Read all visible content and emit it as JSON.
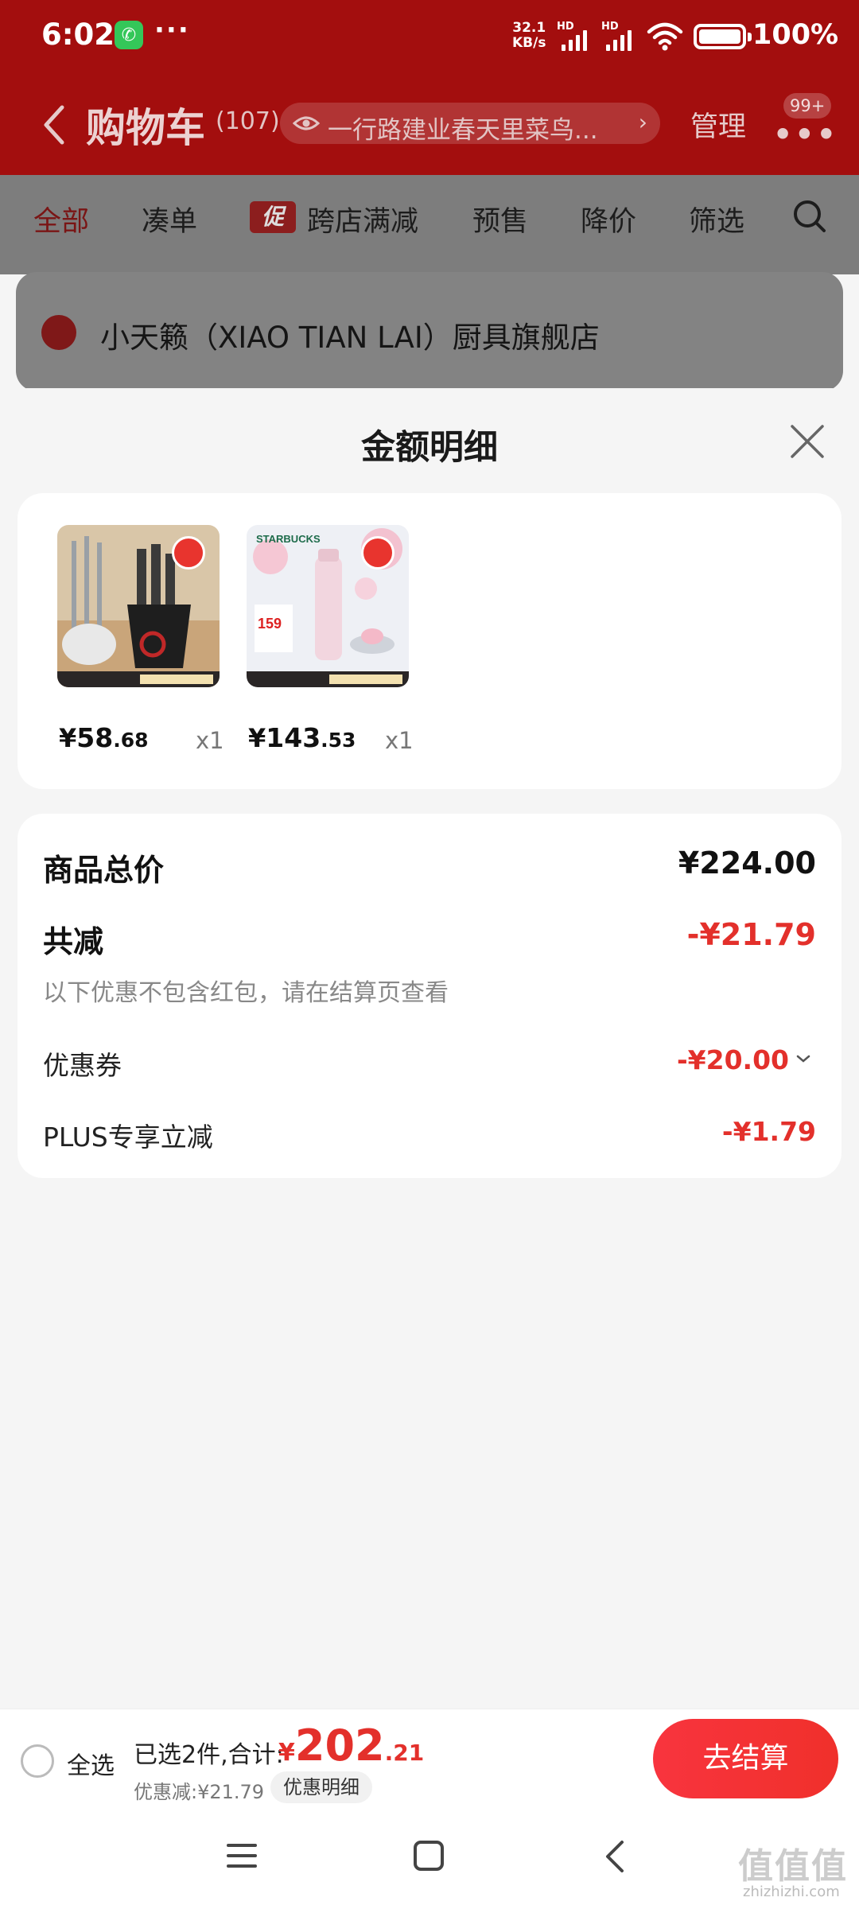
{
  "status_bar": {
    "time": "6:02",
    "more": "···",
    "net_speed_value": "32.1",
    "net_speed_unit": "KB/s",
    "sim1_label": "HD",
    "sim2_label": "HD",
    "battery": "100%"
  },
  "header": {
    "title": "购物车",
    "count": "(107)",
    "address": "一行路建业春天里菜鸟...",
    "manage": "管理",
    "badge": "99+"
  },
  "tabs": {
    "all": "全部",
    "bundle": "凑单",
    "promo_tag": "促",
    "cross_store": "跨店满减",
    "presale": "预售",
    "price_drop": "降价",
    "filter": "筛选"
  },
  "store": {
    "name": "小天籁（XIAO TIAN LAI）厨具旗舰店"
  },
  "sheet": {
    "title": "金额明细",
    "items": [
      {
        "price_yen": "¥",
        "price_int": "58",
        "price_dec": ".68",
        "qty": "x1",
        "thumb": "knife-set"
      },
      {
        "price_yen": "¥",
        "price_int": "143",
        "price_dec": ".53",
        "qty": "x1",
        "thumb": "starbucks-thermos"
      }
    ],
    "thumb_texts": {
      "starbucks": "STARBUCKS",
      "promo_price": "159"
    },
    "summary": {
      "total_label": "商品总价",
      "total_value": "¥224.00",
      "reduce_label": "共减",
      "reduce_value": "-¥21.79",
      "note": "以下优惠不包含红包，请在结算页查看",
      "coupon_label": "优惠券",
      "coupon_value": "-¥20.00",
      "plus_label": "PLUS专享立减",
      "plus_value": "-¥1.79"
    }
  },
  "bottom_bar": {
    "select_all": "全选",
    "selected_text": "已选2件,合计:",
    "total_yen": "¥",
    "total_int": "202",
    "total_dec": ".21",
    "discount_text": "优惠减:¥21.79",
    "detail_chip": "优惠明细",
    "checkout": "去结算"
  },
  "watermark": {
    "text": "值值值",
    "sub": "zhizhizhi.com"
  },
  "colors": {
    "brand_red": "#e3302b",
    "header_red": "#a30e0e",
    "checkout_red": "#f5333a"
  }
}
